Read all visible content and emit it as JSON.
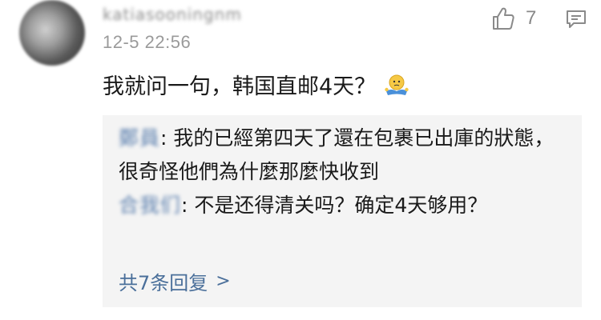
{
  "comment": {
    "username": "katiasooningnm",
    "timestamp": "12-5 22:56",
    "like_count": "7",
    "text": "我就问一句，韩国直邮4天？",
    "emoji": "shrug-emoji"
  },
  "replies": [
    {
      "author": "鄭員",
      "text": ": 我的已經第四天了還在包裹已出庫的狀態，很奇怪他們為什麼那麼快收到"
    },
    {
      "author": "合我们",
      "text": ": 不是还得清关吗？确定4天够用？"
    }
  ],
  "more_replies_label": "共7条回复",
  "more_chevron": ">",
  "colors": {
    "link": "#4a6f9a",
    "reply_bg": "#f4f4f4",
    "timestamp": "#9a9a9a"
  }
}
